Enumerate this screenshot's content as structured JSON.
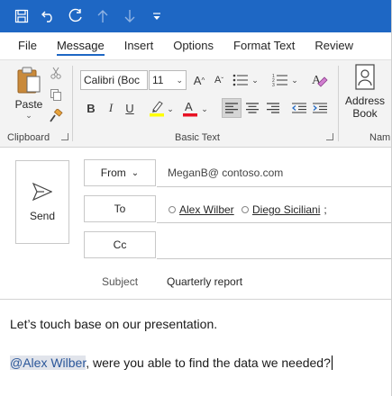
{
  "titlebar": {
    "icons": [
      "save-icon",
      "undo-icon",
      "redo-icon",
      "up-arrow-icon",
      "down-arrow-icon",
      "customize-toolbar-icon"
    ],
    "background": "#1e67c4"
  },
  "tabs": [
    {
      "label": "File"
    },
    {
      "label": "Message"
    },
    {
      "label": "Insert"
    },
    {
      "label": "Options"
    },
    {
      "label": "Format Text"
    },
    {
      "label": "Review"
    }
  ],
  "active_tab": "Message",
  "ribbon": {
    "clipboard": {
      "paste_label": "Paste",
      "group_label": "Clipboard"
    },
    "basic_text": {
      "font_name": "Calibri (Boc",
      "font_size": "11",
      "bold": "B",
      "italic": "I",
      "underline": "U",
      "group_label": "Basic Text"
    },
    "names": {
      "address_book_line1": "Address",
      "address_book_line2": "Book",
      "group_label": "Nam"
    }
  },
  "compose": {
    "send_label": "Send",
    "from_label": "From",
    "from_value": "MeganB@ contoso.com",
    "to_label": "To",
    "to_recipients": [
      "Alex Wilber",
      "Diego Siciliani"
    ],
    "to_separator": ";",
    "cc_label": "Cc",
    "subject_label": "Subject",
    "subject_value": "Quarterly report"
  },
  "body": {
    "line1": "Let’s touch base on our presentation.",
    "mention": "@Alex Wilber",
    "line2_rest": ", were you able to find the data we needed?"
  },
  "colors": {
    "accent": "#1e67c4",
    "highlight_yellow": "#ffff00",
    "font_red": "#e81123",
    "mention_bg": "#e1e4eb"
  }
}
